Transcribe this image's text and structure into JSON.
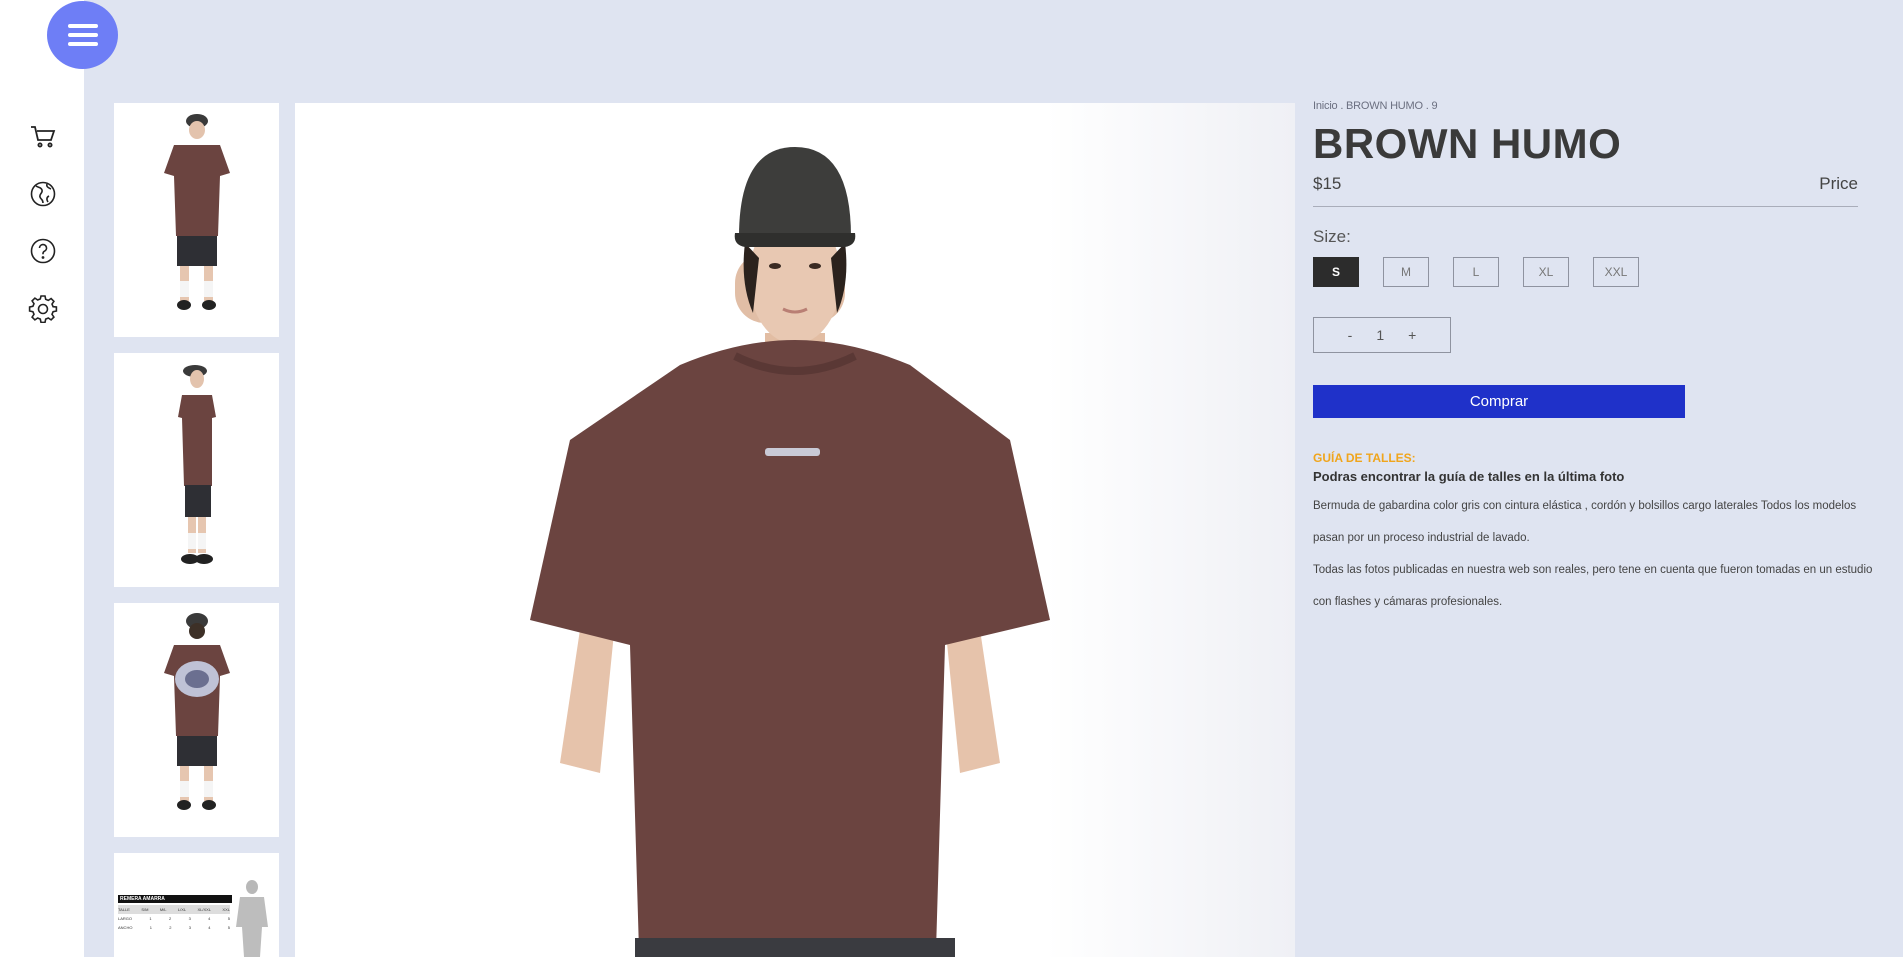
{
  "product": {
    "breadcrumb": "Inicio . BROWN HUMO . 9",
    "title": "BROWN HUMO",
    "price": "$15",
    "price_label": "Price",
    "size_label": "Size:",
    "sizes": [
      "S",
      "M",
      "L",
      "XL",
      "XXL"
    ],
    "selected_size": "S",
    "quantity": {
      "minus": "-",
      "value": "1",
      "plus": "+"
    },
    "buy_label": "Comprar",
    "guide_title": "GUÍA DE TALLES:",
    "guide_subtitle": "Podras encontrar la guía de talles en la última foto",
    "description_1": "Bermuda de gabardina color gris con cintura elástica , cordón y bolsillos cargo laterales Todos los modelos pasan por un proceso industrial de lavado.",
    "description_2": "Todas las fotos publicadas en nuestra web son reales, pero tene en cuenta que fueron tomadas en un estudio con flashes y cámaras profesionales."
  },
  "size_chart": {
    "title": "REMERA AMARRA",
    "headers": [
      "TALLE",
      "S/M",
      "M/L",
      "L/XL",
      "XL/XXL",
      "XXL"
    ],
    "rows": [
      [
        "LARGO",
        "1",
        "2",
        "3",
        "4",
        "5"
      ],
      [
        "ANCHO",
        "1",
        "2",
        "3",
        "4",
        "5"
      ]
    ]
  },
  "icons": {
    "menu": "hamburger-icon",
    "cart": "cart-icon",
    "globe": "globe-icon",
    "help": "help-icon",
    "settings": "gear-icon"
  },
  "colors": {
    "background": "#dfe4f1",
    "menu_button": "#6e7ef6",
    "buy_button": "#1f31c9",
    "guide_accent": "#f0a51c",
    "selected_size": "#2c2c2c",
    "shirt": "#6b4440"
  }
}
